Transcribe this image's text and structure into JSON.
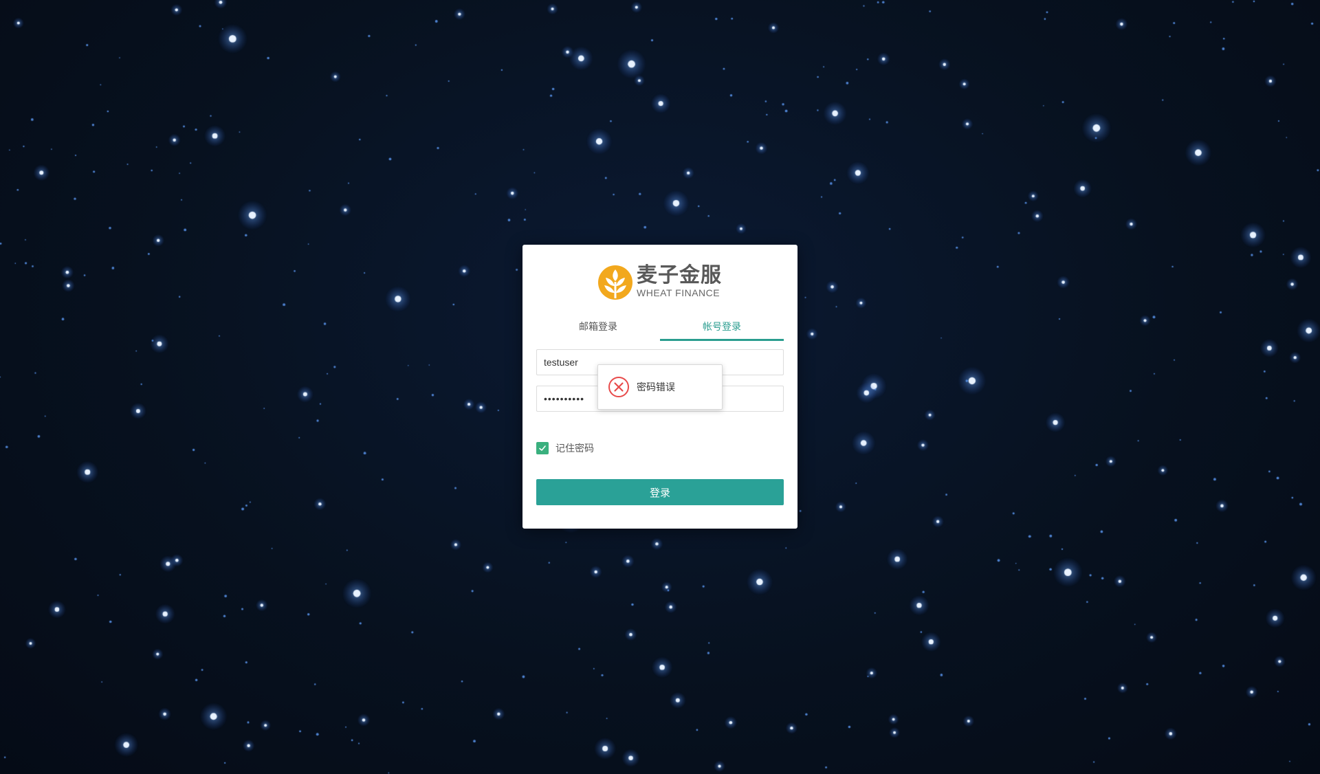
{
  "brand": {
    "name_cn": "麦子金服",
    "name_en": "WHEAT FINANCE",
    "accent_color": "#f2a81d"
  },
  "tabs": [
    {
      "label": "邮箱登录",
      "active": false
    },
    {
      "label": "帐号登录",
      "active": true
    }
  ],
  "form": {
    "username_value": "testuser",
    "password_value": "••••••••••",
    "remember_label": "记住密码",
    "remember_checked": true,
    "submit_label": "登录"
  },
  "toast": {
    "message": "密码错误",
    "icon": "error-circle-icon"
  },
  "colors": {
    "primary": "#2aa197",
    "tab_active": "#2a9d8f",
    "checkbox": "#3ab07e",
    "error": "#e84a4a",
    "background": "#07111f"
  }
}
